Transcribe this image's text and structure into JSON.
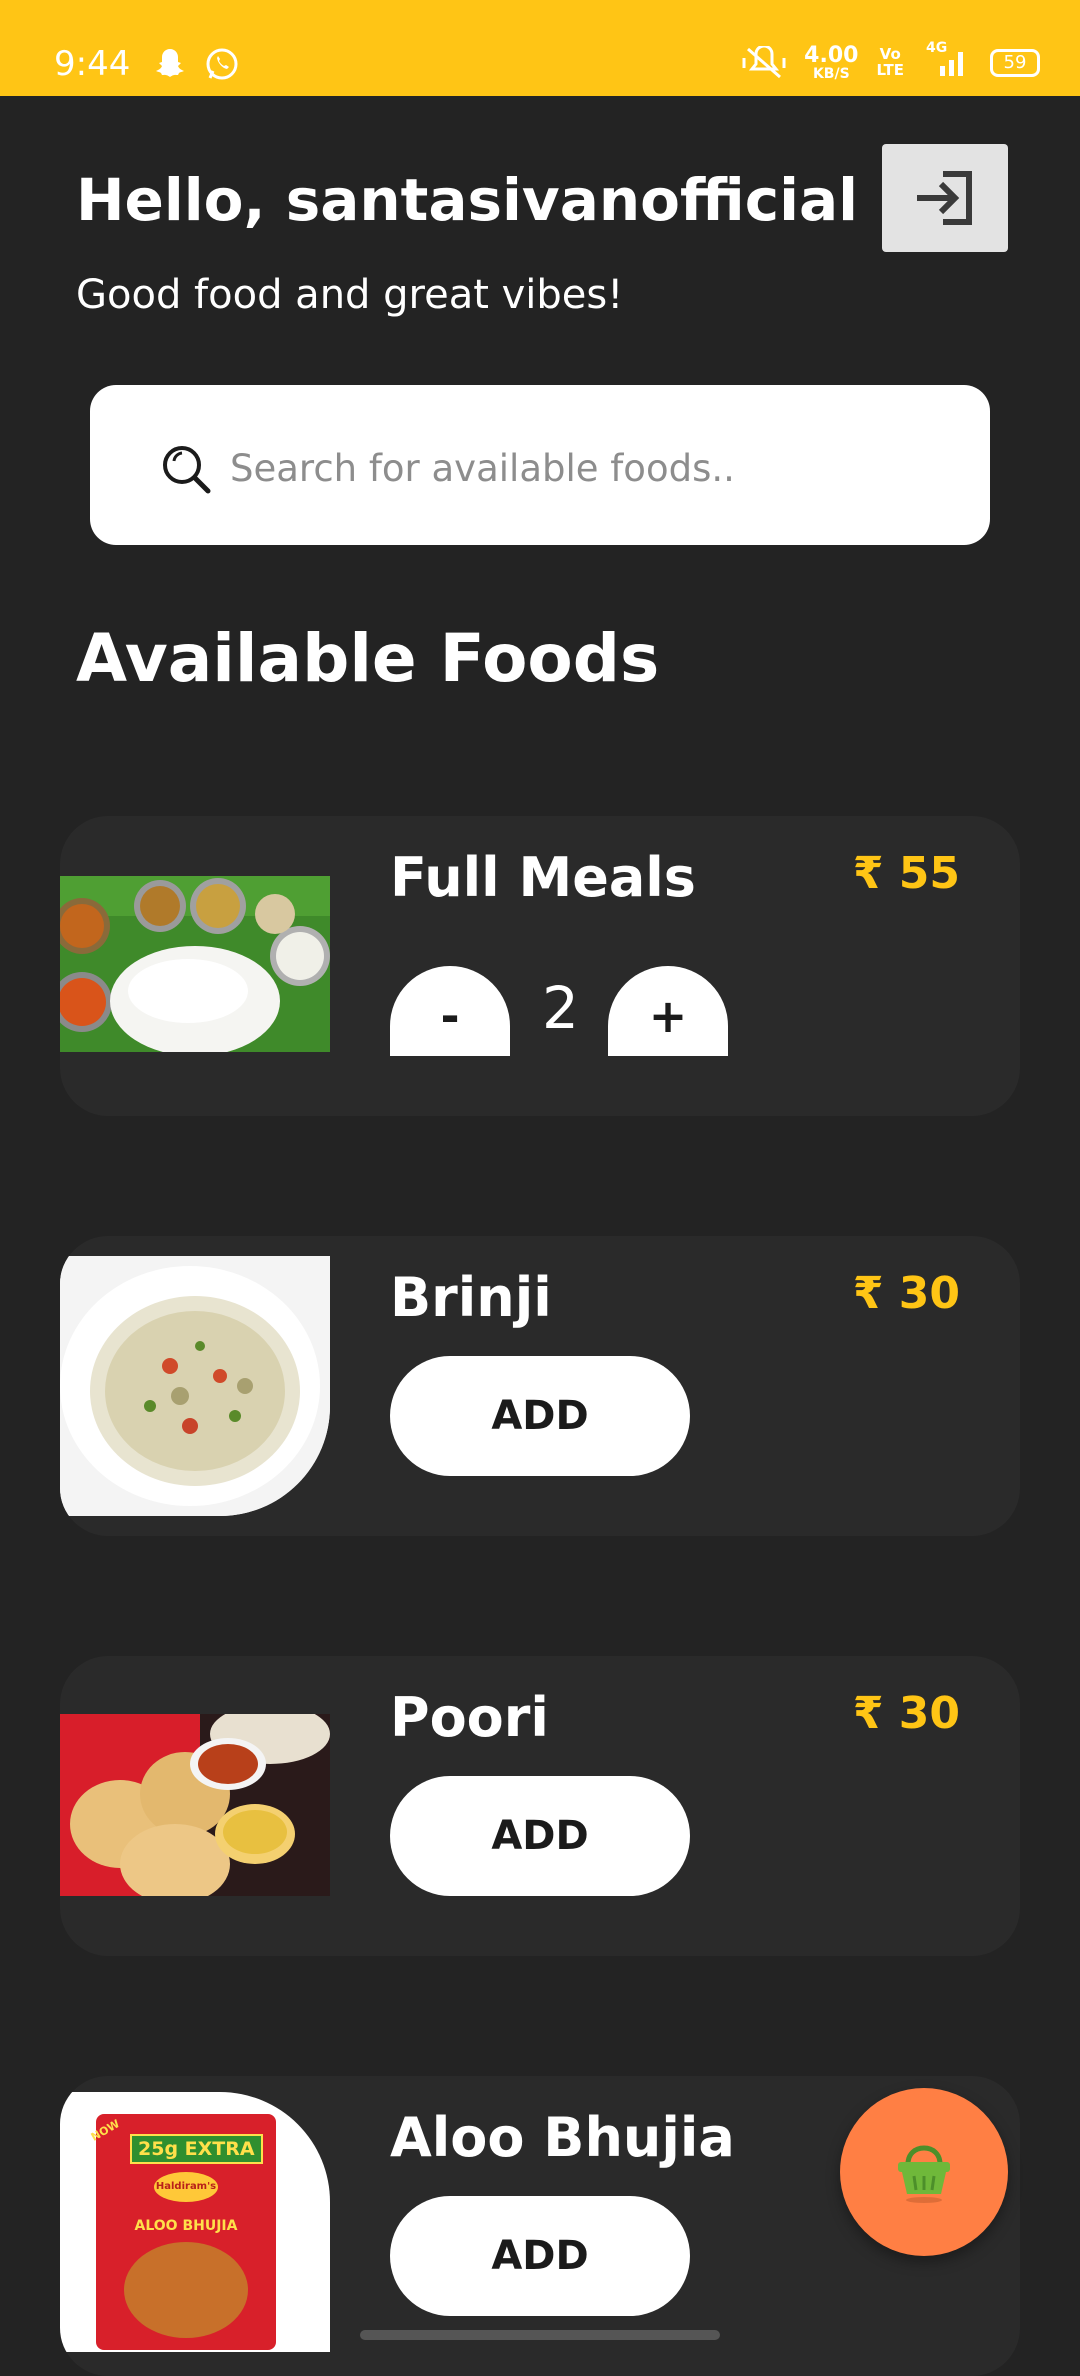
{
  "status_bar": {
    "time": "9:44",
    "network_speed": "4.00",
    "network_speed_unit": "KB/S",
    "volte_top": "Vo",
    "volte_bottom": "LTE",
    "network_type": "4G",
    "battery": "59",
    "icons": [
      "snapchat-icon",
      "whatsapp-icon",
      "mute-icon",
      "signal-icon",
      "battery-icon"
    ]
  },
  "header": {
    "greeting": "Hello, santasivanofficial !",
    "tagline": "Good food and great vibes!",
    "logout_icon": "logout-icon"
  },
  "search": {
    "placeholder": "Search for available foods..",
    "icon": "search-icon"
  },
  "section_title": "Available Foods",
  "foods": [
    {
      "name": "Full Meals",
      "price": "₹ 55",
      "quantity": "2",
      "minus_label": "-",
      "plus_label": "+"
    },
    {
      "name": "Brinji",
      "price": "₹ 30",
      "button_label": "ADD"
    },
    {
      "name": "Poori",
      "price": "₹ 30",
      "button_label": "ADD"
    },
    {
      "name": "Aloo Bhujia",
      "button_label": "ADD",
      "package_text": {
        "badge": "25g EXTRA",
        "brand": "Haldiram's",
        "product": "ALOO BHUJIA",
        "corner": "NOW"
      }
    }
  ],
  "fab": {
    "icon": "shopping-basket-icon"
  },
  "colors": {
    "accent": "#FFC515",
    "background": "#232323",
    "card": "#2a2a2a",
    "fab": "#FF7F44"
  }
}
